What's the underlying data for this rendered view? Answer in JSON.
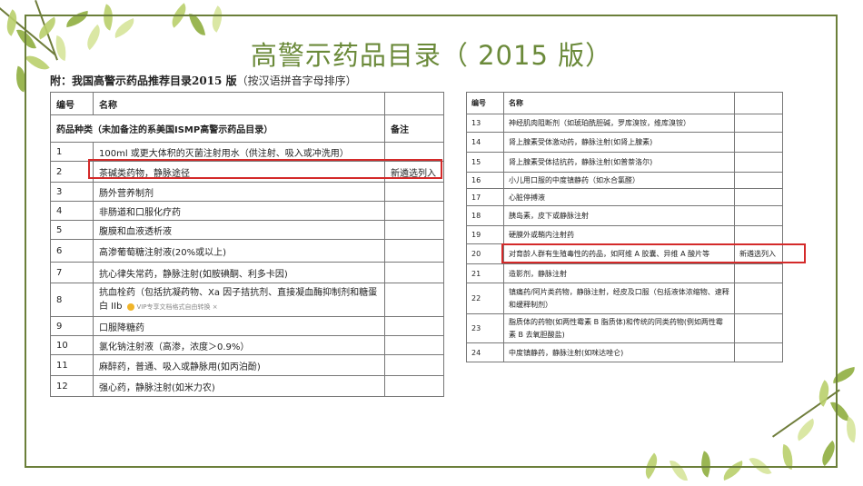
{
  "title": "高警示药品目录（ 2015 版）",
  "subtitle": {
    "bold": "附：我国高警示药品推荐目录2015 版",
    "note": "（按汉语拼音字母排序）"
  },
  "left_table": {
    "header": {
      "no": "编号",
      "name": "名称"
    },
    "category_row": {
      "label": "药品种类（未加备注的系美国ISMP高警示药品目录）",
      "remark_header": "备注"
    },
    "rows": [
      {
        "no": "1",
        "name": "100ml 或更大体积的灭菌注射用水（供注射、吸入或冲洗用）",
        "remark": ""
      },
      {
        "no": "2",
        "name": "茶碱类药物，静脉途径",
        "remark": "新遴选列入"
      },
      {
        "no": "3",
        "name": "肠外营养制剂",
        "remark": ""
      },
      {
        "no": "4",
        "name": "非肠道和口服化疗药",
        "remark": ""
      },
      {
        "no": "5",
        "name": "腹膜和血液透析液",
        "remark": ""
      },
      {
        "no": "6",
        "name": "高渗葡萄糖注射液(20%或以上)",
        "remark": ""
      },
      {
        "no": "7",
        "name": "抗心律失常药，静脉注射(如胺碘酮、利多卡因)",
        "remark": ""
      },
      {
        "no": "8",
        "name": "抗血栓药（包括抗凝药物、Xa 因子拮抗剂、直接凝血酶抑制剂和糖蛋白 IIb",
        "remark": ""
      },
      {
        "no": "9",
        "name": "口服降糖药",
        "remark": ""
      },
      {
        "no": "10",
        "name": "氯化钠注射液（高渗，浓度＞0.9%）",
        "remark": ""
      },
      {
        "no": "11",
        "name": "麻醉药，普通、吸入或静脉用(如丙泊酚)",
        "remark": ""
      },
      {
        "no": "12",
        "name": "强心药，静脉注射(如米力农)",
        "remark": ""
      }
    ],
    "watermark": "VIP专享文档格式自由转换"
  },
  "right_table": {
    "header": {
      "no": "编号",
      "name": "名称"
    },
    "rows": [
      {
        "no": "13",
        "name": "神经肌肉阻断剂（如琥珀酰胆碱，罗库溴铵，维库溴铵）",
        "remark": ""
      },
      {
        "no": "14",
        "name": "肾上腺素受体激动药，静脉注射(如肾上腺素)",
        "remark": ""
      },
      {
        "no": "15",
        "name": "肾上腺素受体拮抗药，静脉注射(如普萘洛尔)",
        "remark": ""
      },
      {
        "no": "16",
        "name": "小儿用口服的中度镇静药（如水合氯醛）",
        "remark": ""
      },
      {
        "no": "17",
        "name": "心脏停搏液",
        "remark": ""
      },
      {
        "no": "18",
        "name": "胰岛素，皮下或静脉注射",
        "remark": ""
      },
      {
        "no": "19",
        "name": "硬膜外或鞘内注射药",
        "remark": ""
      },
      {
        "no": "20",
        "name": "对育龄人群有生殖毒性的药品，如阿维 A 胶囊、异维 A 酸片等",
        "remark": "新遴选列入"
      },
      {
        "no": "21",
        "name": "造影剂，静脉注射",
        "remark": ""
      },
      {
        "no": "22",
        "name": "镇痛药/阿片类药物，静脉注射，经皮及口服（包括液体浓缩物、速释和缓释制剂）",
        "remark": ""
      },
      {
        "no": "23",
        "name": "脂质体的药物(如两性霉素 B 脂质体)和传统的同类药物(例如两性霉素 B 去氧胆酸盐)",
        "remark": ""
      },
      {
        "no": "24",
        "name": "中度镇静药，静脉注射(如咪达唑仑)",
        "remark": ""
      }
    ]
  },
  "colors": {
    "title": "#6b8a3a",
    "frame": "#6b7f3a",
    "highlight": "#d42a2a"
  }
}
